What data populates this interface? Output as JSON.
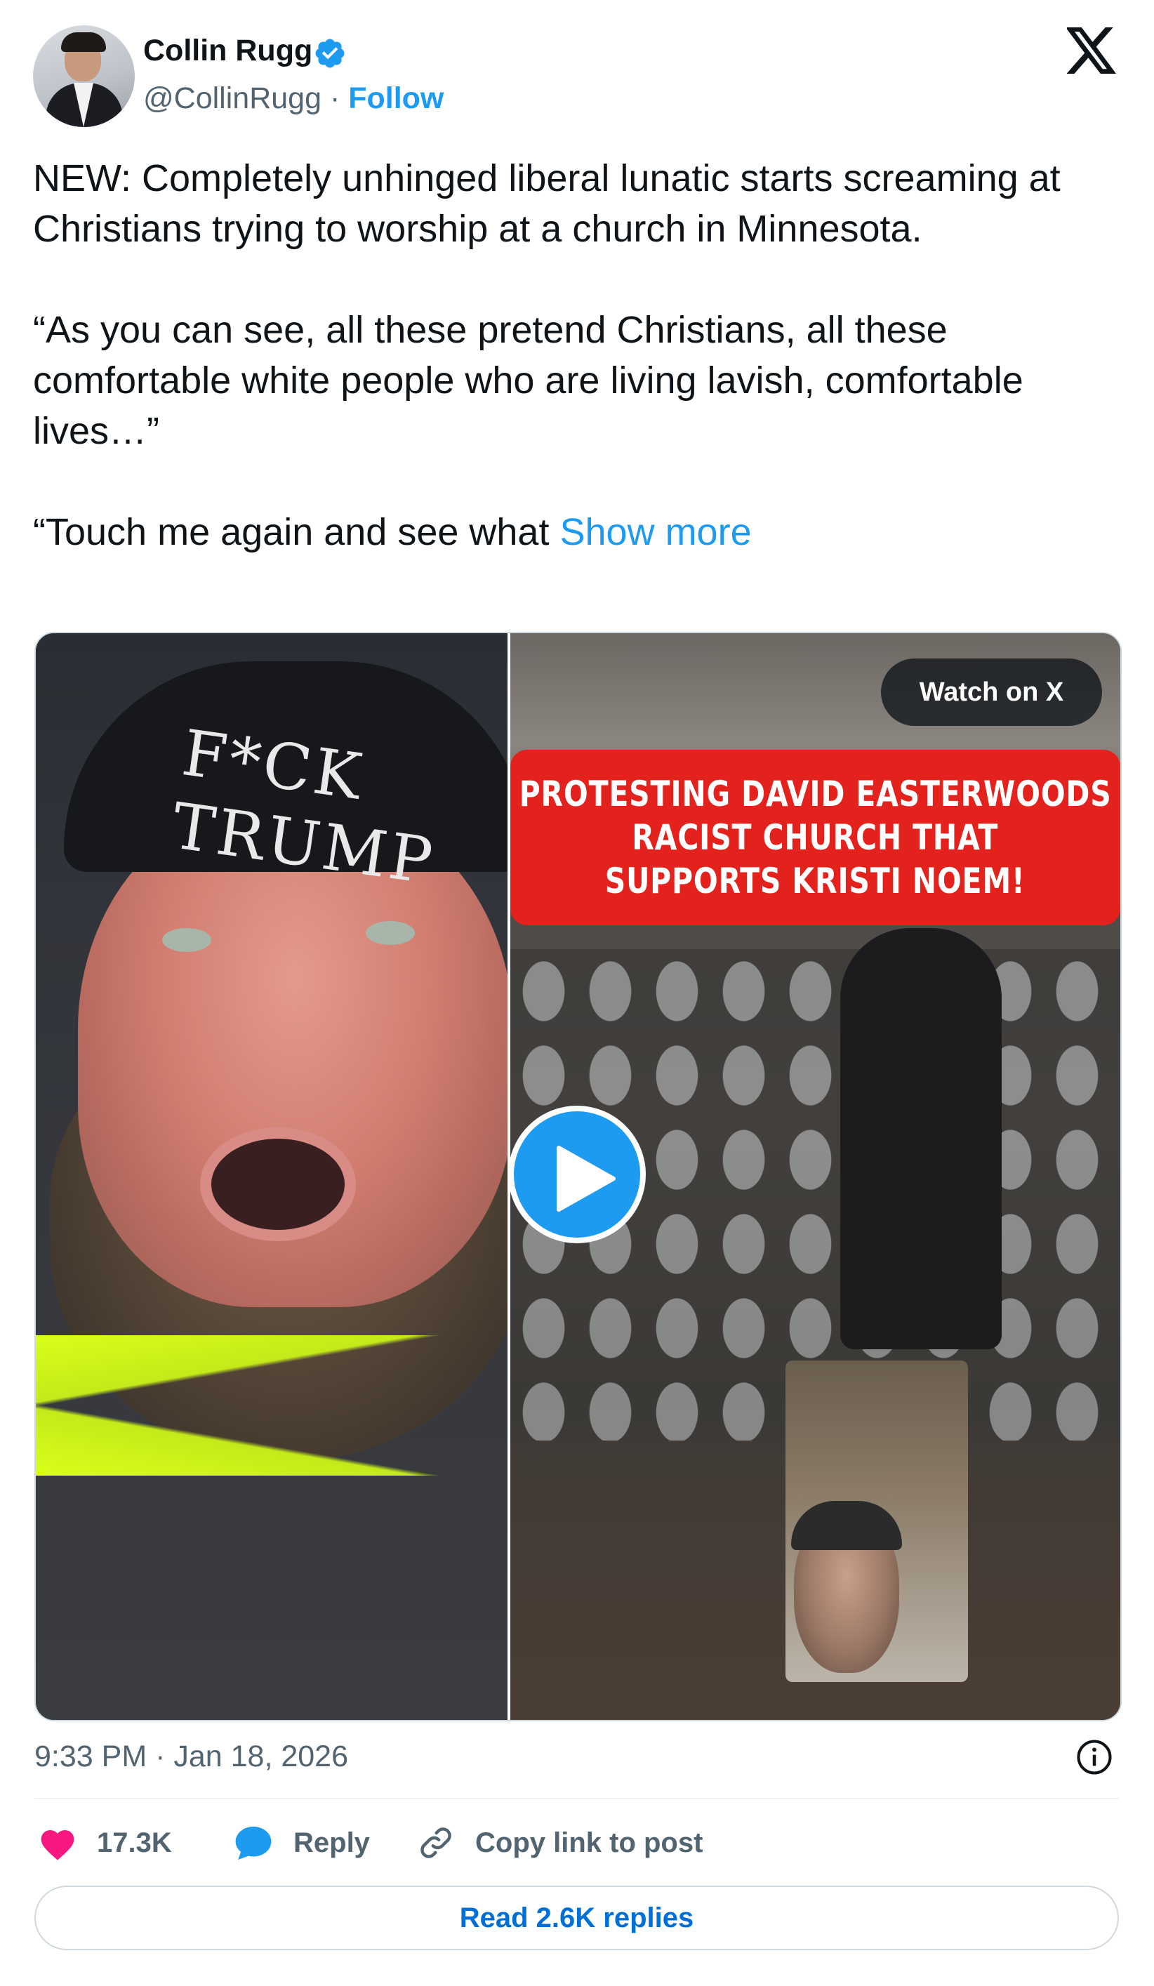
{
  "author": {
    "name": "Collin Rugg",
    "handle": "@CollinRugg",
    "separator": "·",
    "follow_label": "Follow"
  },
  "tweet": {
    "paragraphs": [
      "NEW: Completely unhinged liberal lunatic starts screaming at Christians trying to worship at a church in Minnesota.",
      "“As you can see, all these pretend Christians, all these comfortable white people who are living lavish, comfortable lives…”",
      "“Touch me again and see what"
    ],
    "show_more_label": "Show more"
  },
  "media": {
    "watch_label": "Watch on X",
    "beanie_text": "F*CK TRUMP",
    "banner_lines": [
      "PROTESTING DAVID EASTERWOODS",
      "RACIST CHURCH THAT",
      "SUPPORTS KRISTI NOEM!"
    ]
  },
  "footer": {
    "timestamp": "9:33 PM · Jan 18, 2026",
    "like_count": "17.3K",
    "reply_label": "Reply",
    "copy_label": "Copy link to post",
    "read_replies_label": "Read 2.6K replies"
  },
  "icons": {
    "verified": "verified-badge-icon",
    "x_logo": "x-logo-icon",
    "play": "play-icon",
    "info": "info-icon",
    "like": "heart-icon",
    "reply": "speech-bubble-icon",
    "copy": "link-icon"
  },
  "colors": {
    "accent": "#1d9bf0",
    "text": "#0f1419",
    "muted": "#536471",
    "like": "#f91880",
    "banner": "#e4221d",
    "link_button": "#006fd6"
  }
}
